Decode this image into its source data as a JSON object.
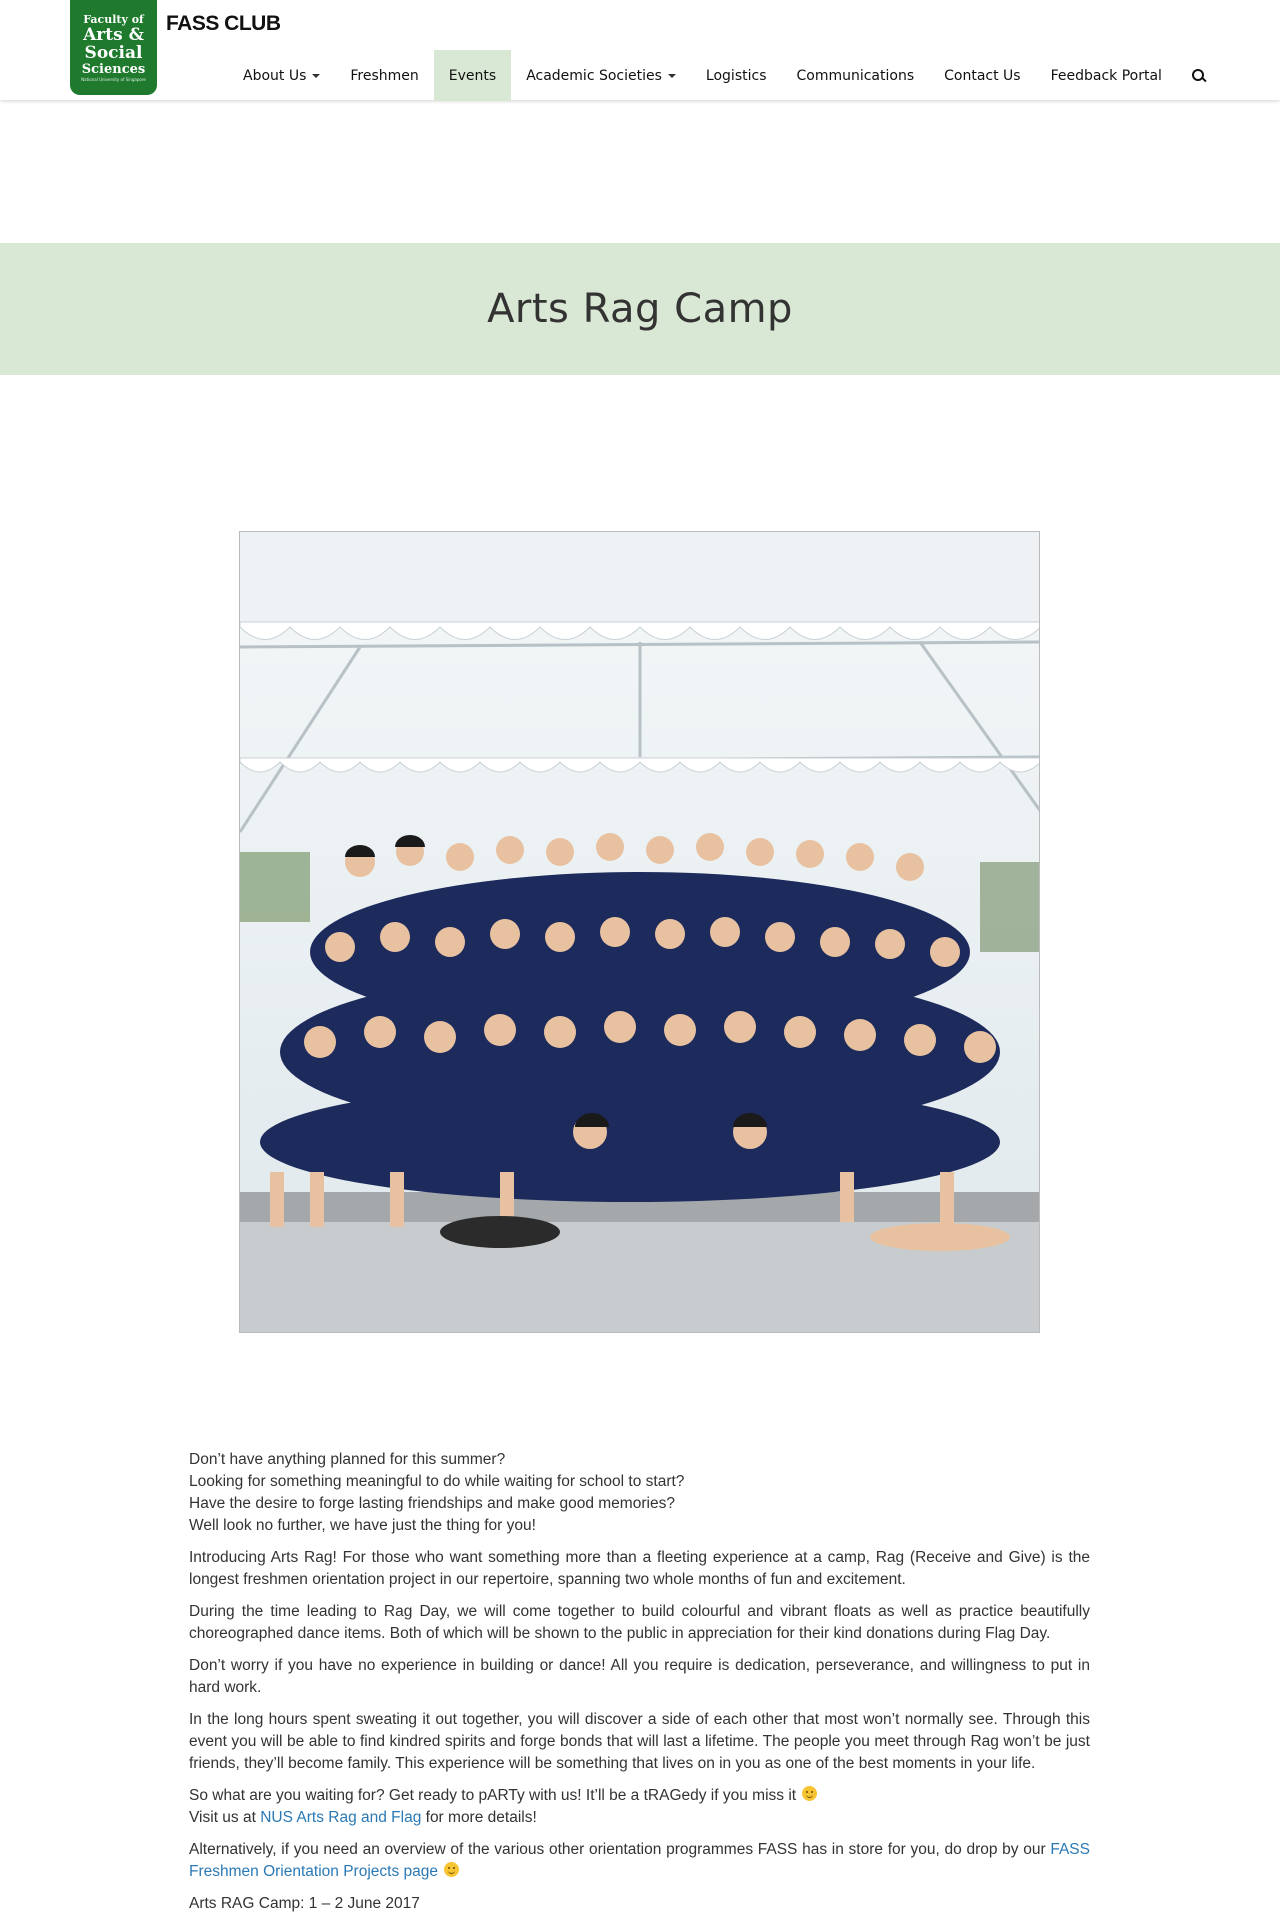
{
  "header": {
    "logo_lines": [
      "Faculty of",
      "Arts &",
      "Social",
      "Sciences",
      "National University of Singapore"
    ],
    "brand": "FASS CLUB",
    "nav": [
      {
        "label": "About Us",
        "dropdown": true,
        "active": false
      },
      {
        "label": "Freshmen",
        "dropdown": false,
        "active": false
      },
      {
        "label": "Events",
        "dropdown": false,
        "active": true
      },
      {
        "label": "Academic Societies",
        "dropdown": true,
        "active": false
      },
      {
        "label": "Logistics",
        "dropdown": false,
        "active": false
      },
      {
        "label": "Communications",
        "dropdown": false,
        "active": false
      },
      {
        "label": "Contact Us",
        "dropdown": false,
        "active": false
      },
      {
        "label": "Feedback Portal",
        "dropdown": false,
        "active": false
      }
    ],
    "search_icon": "search-icon",
    "active_color": "#d9e8d4",
    "logo_color": "#1f7a2e"
  },
  "hero": {
    "title": "Arts Rag Camp",
    "background": "#d9e8d4"
  },
  "photo": {
    "alt": "Group photo of Arts Rag participants in navy Arts Rag t-shirts under a white tent"
  },
  "content": {
    "intro_lines": [
      "Don’t have anything planned for this summer?",
      "Looking for something meaningful to do while waiting for school to start?",
      "Have the desire to forge lasting friendships and make good memories?",
      "Well look no further, we have just the thing for you!"
    ],
    "p1": "Introducing Arts Rag! For those who want something more than a fleeting experience at a camp, Rag (Receive and Give) is the longest freshmen orientation project in our repertoire, spanning two whole months of fun and excitement.",
    "p2": "During the time leading to Rag Day, we will come together to build colourful and vibrant floats as well as practice beautifully choreographed dance items. Both of which will be shown to the public in appreciation for their kind donations during Flag Day.",
    "p3": "Don’t worry if you have no experience in building or dance! All you require is dedication, perseverance, and willingness to put in hard work.",
    "p4": "In the long hours spent sweating it out together, you will discover a side of each other that most won’t normally see. Through this event you will be able to find kindred spirits and forge bonds that will last a lifetime. The people you meet through Rag won’t be just friends, they’ll become family. This experience will be something that lives on in you as one of the best moments in your life.",
    "p5_line1": "So what are you waiting for? Get ready to pARTy with us! It’ll be a tRAGedy if you miss it",
    "p5_visit_prefix": "Visit us at ",
    "p5_link": "NUS Arts Rag and Flag",
    "p5_visit_suffix": " for more details!",
    "p6_text": "Alternatively, if you need an overview of the various other orientation programmes FASS has in store for you, do drop by our ",
    "p6_link": "FASS Freshmen Orientation Projects page",
    "date_line": "Arts RAG Camp: 1 – 2 June 2017",
    "link_color": "#2a79b5"
  }
}
